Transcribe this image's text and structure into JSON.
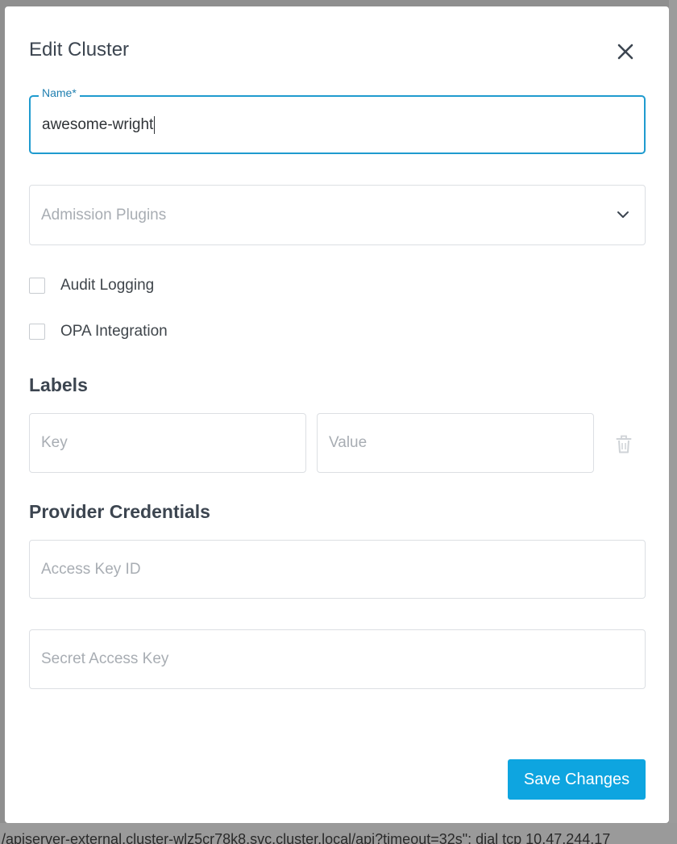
{
  "modal": {
    "title": "Edit Cluster",
    "close_icon": "close-icon"
  },
  "form": {
    "name_label": "Name*",
    "name_value": "awesome-wright",
    "admission_plugins_placeholder": "Admission Plugins",
    "audit_logging_label": "Audit Logging",
    "audit_logging_checked": false,
    "opa_integration_label": "OPA Integration",
    "opa_integration_checked": false
  },
  "labels_section": {
    "title": "Labels",
    "key_placeholder": "Key",
    "value_placeholder": "Value",
    "delete_icon": "trash-icon"
  },
  "credentials_section": {
    "title": "Provider Credentials",
    "access_key_placeholder": "Access Key ID",
    "secret_key_placeholder": "Secret Access Key"
  },
  "footer": {
    "save_label": "Save Changes"
  },
  "background": {
    "bottom_text": "/apiserver-external.cluster-wlz5cr78k8.svc.cluster.local/api?timeout=32s\": dial tcp 10.47.244.17"
  },
  "colors": {
    "accent": "#1f9bcf",
    "save_button": "#0ea5e0",
    "overlay": "#8f8f8f"
  }
}
